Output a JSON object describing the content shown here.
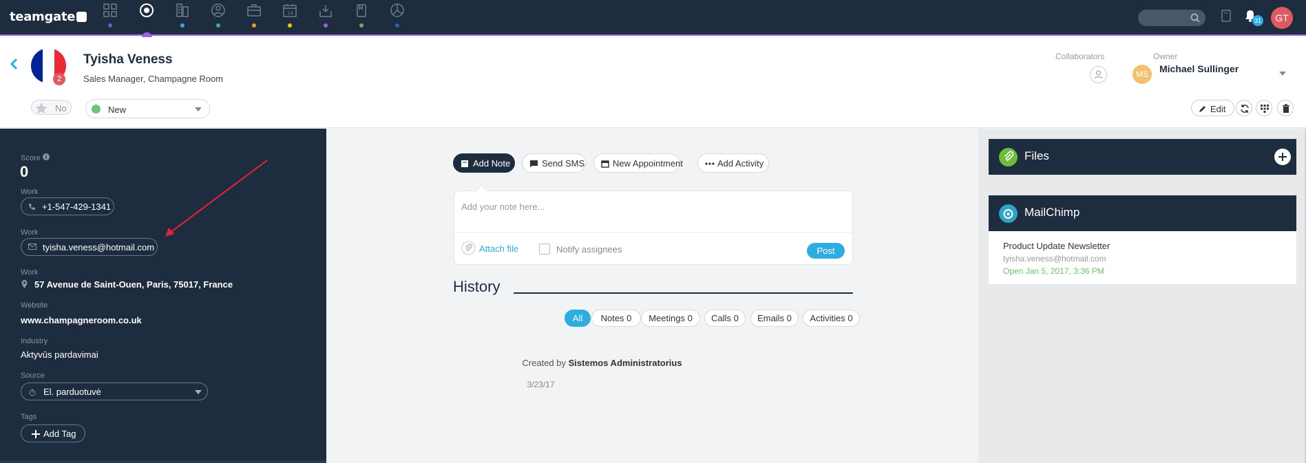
{
  "app": {
    "logo_text": "teamgate"
  },
  "topnav": {
    "items": [
      {
        "name": "dashboard",
        "dot_color": "#6a5acd"
      },
      {
        "name": "contacts",
        "dot_color": "#a35fe0"
      },
      {
        "name": "companies",
        "dot_color": "#2eaee0"
      },
      {
        "name": "leads",
        "dot_color": "#3cb371"
      },
      {
        "name": "deals",
        "dot_color": "#f0932b"
      },
      {
        "name": "calendar",
        "dot_color": "#f1c40f"
      },
      {
        "name": "inbox",
        "dot_color": "#a35fe0"
      },
      {
        "name": "docs",
        "dot_color": "#6ab04c"
      },
      {
        "name": "reports",
        "dot_color": "#2962a8"
      }
    ],
    "notifications_count": "31",
    "user_initials": "GT"
  },
  "contact": {
    "name": "Tyisha Veness",
    "subtitle": "Sales Manager, Champagne Room",
    "flag_badge": "2",
    "favorite_label": "No",
    "status": "New",
    "status_color": "#73c17a"
  },
  "header_right": {
    "collaborators_label": "Collaborators",
    "owner_label": "Owner",
    "owner_initials": "MS",
    "owner_name": "Michael Sullinger",
    "edit_label": "Edit"
  },
  "sidebar": {
    "score_label": "Score",
    "score_value": "0",
    "phone_label": "Work",
    "phone": "+1-547-429-1341",
    "email_label": "Work",
    "email": "tyisha.veness@hotmail.com",
    "address_label": "Work",
    "address": "57 Avenue de Saint-Ouen, Paris, 75017, France",
    "website_label": "Website",
    "website": "www.champagneroom.co.uk",
    "industry_label": "Industry",
    "industry": "Aktyvūs pardavimai",
    "source_label": "Source",
    "source": "El. parduotuvė",
    "tags_label": "Tags",
    "add_tag_label": "Add Tag"
  },
  "actions": {
    "add_note": "Add Note",
    "send_sms": "Send SMS",
    "new_appointment": "New Appointment",
    "add_activity": "Add Activity"
  },
  "note": {
    "placeholder": "Add your note here...",
    "attach_label": "Attach file",
    "notify_label": "Notify assignees",
    "post_label": "Post"
  },
  "history": {
    "title": "History",
    "filters": [
      "All",
      "Notes 0",
      "Meetings 0",
      "Calls 0",
      "Emails 0",
      "Activities 0"
    ],
    "created_prefix": "Created by",
    "created_by": "Sistemos Administratorius",
    "date": "3/23/17"
  },
  "widgets": {
    "files_title": "Files",
    "mailchimp_title": "MailChimp",
    "mc_campaign": "Product Update Newsletter",
    "mc_email": "tyisha.veness@hotmail.com",
    "mc_open": "Open Jan 5, 2017, 3:36 PM"
  }
}
